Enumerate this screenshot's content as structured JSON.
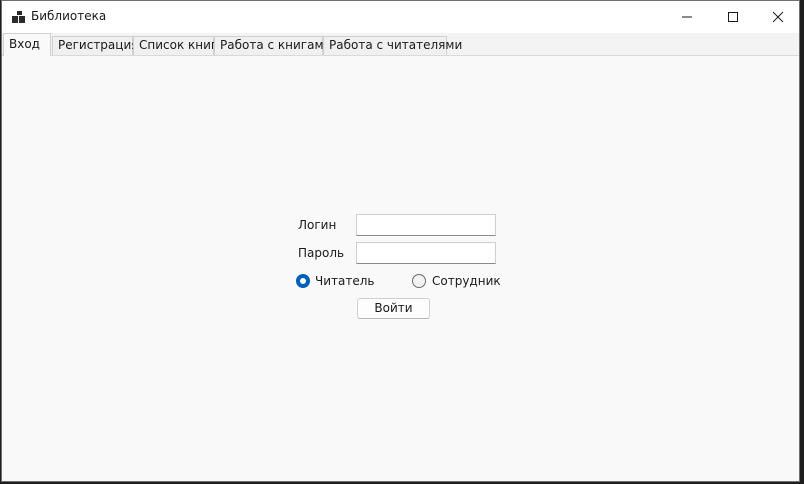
{
  "window": {
    "title": "Библиотека"
  },
  "tabs": [
    {
      "label": "Вход",
      "active": true
    },
    {
      "label": "Регистрация",
      "active": false
    },
    {
      "label": "Список книг",
      "active": false
    },
    {
      "label": "Работа с книгами",
      "active": false
    },
    {
      "label": "Работа с читателями",
      "active": false
    }
  ],
  "login_form": {
    "login_label": "Логин",
    "login_value": "",
    "password_label": "Пароль",
    "password_value": "",
    "role_reader_label": "Читатель",
    "role_reader_selected": true,
    "role_employee_label": "Сотрудник",
    "role_employee_selected": false,
    "submit_label": "Войти"
  },
  "colors": {
    "accent": "#005fb8",
    "background": "#f9f9f9"
  }
}
